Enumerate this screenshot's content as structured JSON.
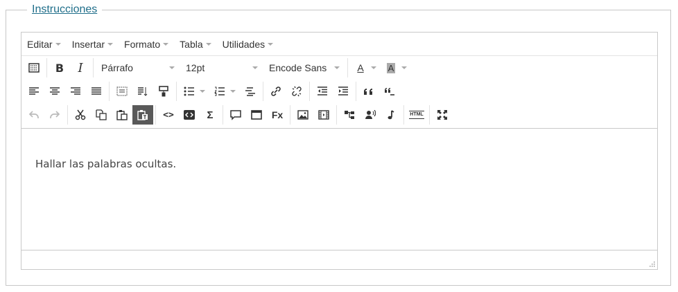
{
  "fieldset": {
    "legend": "Instrucciones"
  },
  "menubar": {
    "items": [
      {
        "label": "Editar"
      },
      {
        "label": "Insertar"
      },
      {
        "label": "Formato"
      },
      {
        "label": "Tabla"
      },
      {
        "label": "Utilidades"
      }
    ]
  },
  "toolbar": {
    "block_format": "Párrafo",
    "font_size": "12pt",
    "font_family": "Encode Sans",
    "bold_label": "B",
    "italic_label": "I",
    "text_color_label": "A",
    "bg_color_label": "A",
    "code_label": "<>",
    "sigma_label": "Σ",
    "fx_label": "Fx",
    "html_label": "HTML",
    "active_button": "paste-as-text"
  },
  "content": {
    "text": "Hallar las palabras ocultas."
  }
}
